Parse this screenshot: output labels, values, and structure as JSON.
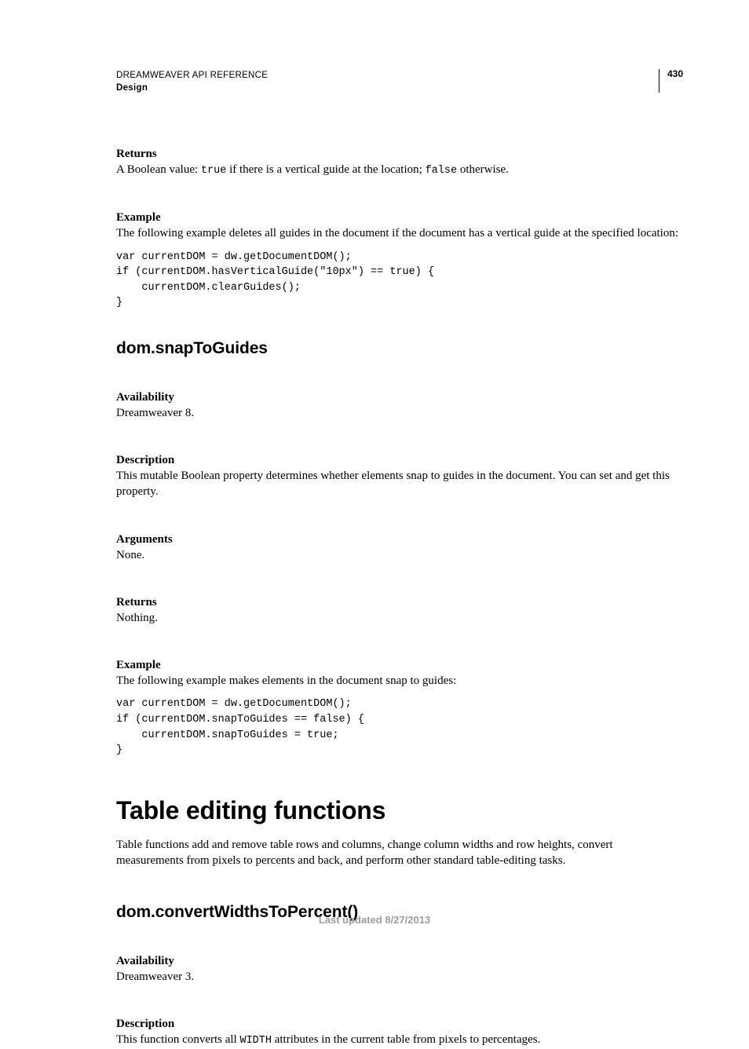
{
  "header": {
    "doc_title": "DREAMWEAVER API REFERENCE",
    "section": "Design",
    "page_number": "430"
  },
  "sec1": {
    "returns_label": "Returns",
    "returns_pre": "A Boolean value: ",
    "returns_code1": "true",
    "returns_mid": " if there is a vertical guide at the location; ",
    "returns_code2": "false",
    "returns_post": " otherwise.",
    "example_label": "Example",
    "example_text": "The following example deletes all guides in the document if the document has a vertical guide at the specified location:",
    "example_code": "var currentDOM = dw.getDocumentDOM();\nif (currentDOM.hasVerticalGuide(\"10px\") == true) {\n    currentDOM.clearGuides();\n}"
  },
  "sec2": {
    "title": "dom.snapToGuides",
    "availability_label": "Availability",
    "availability_text": "Dreamweaver 8.",
    "description_label": "Description",
    "description_text": "This mutable Boolean property determines whether elements snap to guides in the document. You can set and get this property.",
    "arguments_label": "Arguments",
    "arguments_text": "None.",
    "returns_label": "Returns",
    "returns_text": "Nothing.",
    "example_label": "Example",
    "example_text": "The following example makes elements in the document snap to guides:",
    "example_code": "var currentDOM = dw.getDocumentDOM();\nif (currentDOM.snapToGuides == false) {\n    currentDOM.snapToGuides = true;\n}"
  },
  "sec3": {
    "title": "Table editing functions",
    "intro": "Table functions add and remove table rows and columns, change column widths and row heights, convert measurements from pixels to percents and back, and perform other standard table-editing tasks."
  },
  "sec4": {
    "title": "dom.convertWidthsToPercent()",
    "availability_label": "Availability",
    "availability_text": "Dreamweaver 3.",
    "description_label": "Description",
    "description_pre": "This function converts all ",
    "description_code": "WIDTH",
    "description_post": " attributes in the current table from pixels to percentages."
  },
  "footer": {
    "text": "Last updated 8/27/2013"
  }
}
